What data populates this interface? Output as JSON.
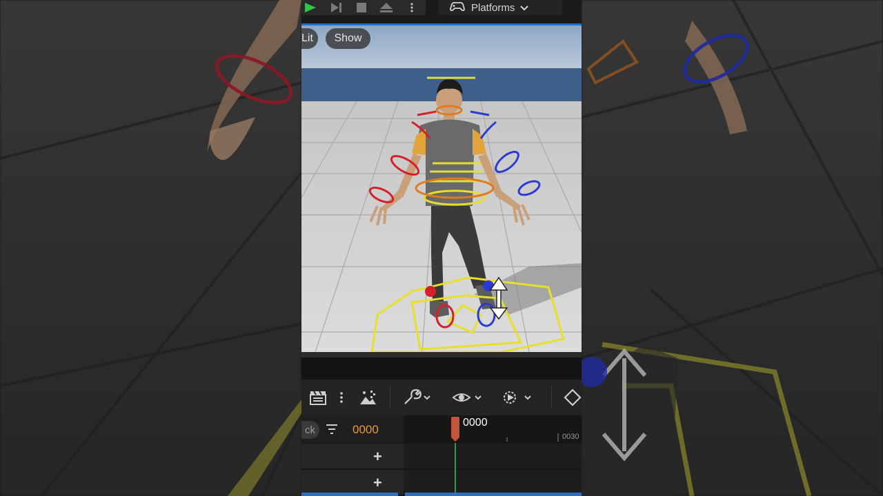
{
  "toolbar": {
    "play_icon": "play-icon",
    "platforms_label": "Platforms"
  },
  "viewport": {
    "lit_label": "Lit",
    "show_label": "Show"
  },
  "sequencer": {
    "search_stub": "ck",
    "current_frame": "0000",
    "playhead_frame": "0000",
    "ruler_mark": "0030"
  },
  "colors": {
    "accent_blue": "#1d6fd6",
    "frame_orange": "#e89a2a",
    "playhead": "#c2553a",
    "play_green": "#34c24a",
    "control_yellow": "#e6e02a",
    "control_red": "#d4202a",
    "control_blue": "#2a3ad4"
  }
}
